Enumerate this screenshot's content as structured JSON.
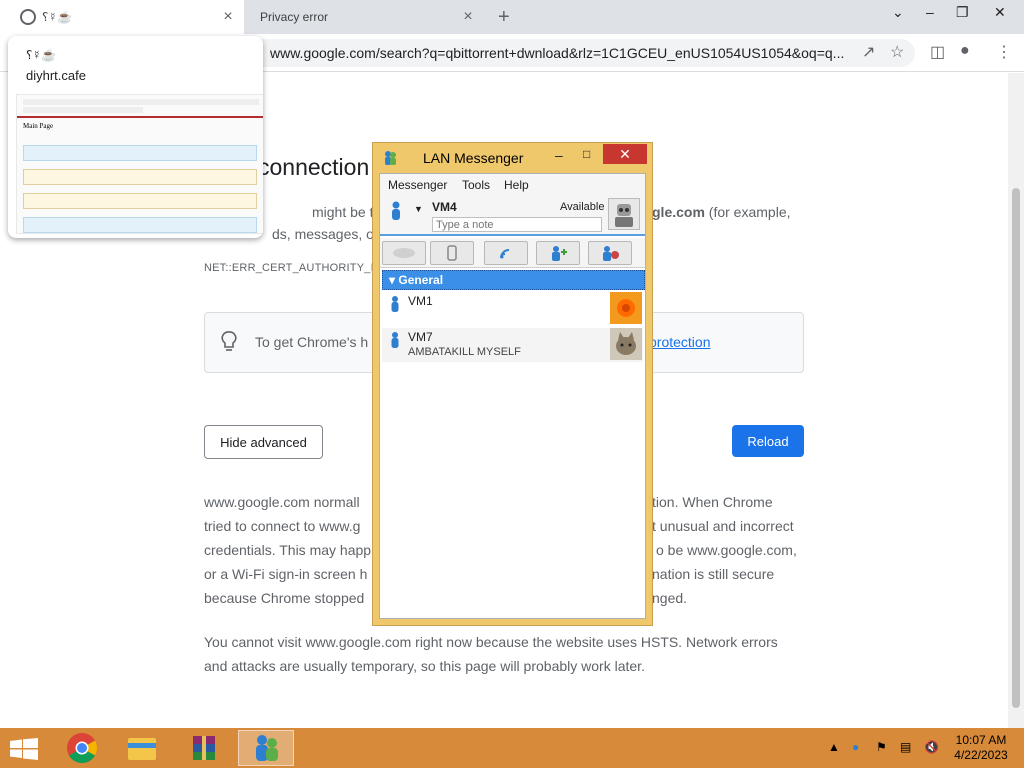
{
  "browser": {
    "tabs": [
      {
        "label": "⸮☿☕"
      },
      {
        "label": "Privacy error"
      }
    ],
    "new_tab_label": "+",
    "close_label": "×",
    "url": "www.google.com/search?q=qbittorrent+dwnload&rlz=1C1GCEU_enUS1054US1054&oq=q..."
  },
  "preview": {
    "title": "⸮☿☕",
    "domain": "diyhrt.cafe",
    "thumb_heading": "Main Page"
  },
  "error_page": {
    "title": "connection",
    "para_line1_left": "might be trying",
    "para_line1_right": "gle.com",
    "para_line1_tail": " (for example,",
    "para_line2": "ds, messages, or c",
    "code": "NET::ERR_CERT_AUTHORITY_INV",
    "tip_text": "To get Chrome's h",
    "tip_link": "protection",
    "hide_advanced": "Hide advanced",
    "reload": "Reload",
    "para2_l1a": "www.google.com normall",
    "para2_l1b": "tion. When Chrome",
    "para2_l2a": "tried to connect to www.g",
    "para2_l2b": "t unusual and incorrect",
    "para2_l3a": "credentials. This may happ",
    "para2_l3b": "o be www.google.com,",
    "para2_l4a": "or a Wi-Fi sign-in screen h",
    "para2_l4b": "nation is still secure",
    "para2_l5a": "because Chrome stopped",
    "para2_l5b": "nged.",
    "para3": "You cannot visit www.google.com right now because the website uses HSTS. Network errors and attacks are usually temporary, so this page will probably work later."
  },
  "lan": {
    "title": "LAN Messenger",
    "menu": [
      "Messenger",
      "Tools",
      "Help"
    ],
    "user": {
      "name": "VM4",
      "status": "Available",
      "note_placeholder": "Type a note"
    },
    "group": "General",
    "contacts": [
      {
        "name": "VM1",
        "note": ""
      },
      {
        "name": "VM7",
        "note": "AMBATAKILL MYSELF"
      }
    ]
  },
  "taskbar": {
    "time": "10:07 AM",
    "date": "4/22/2023"
  },
  "colors": {
    "accent": "#1a73e8",
    "taskbar": "#d68a3a",
    "lan_frame": "#f0c86c",
    "lan_group": "#3c8fe6"
  }
}
